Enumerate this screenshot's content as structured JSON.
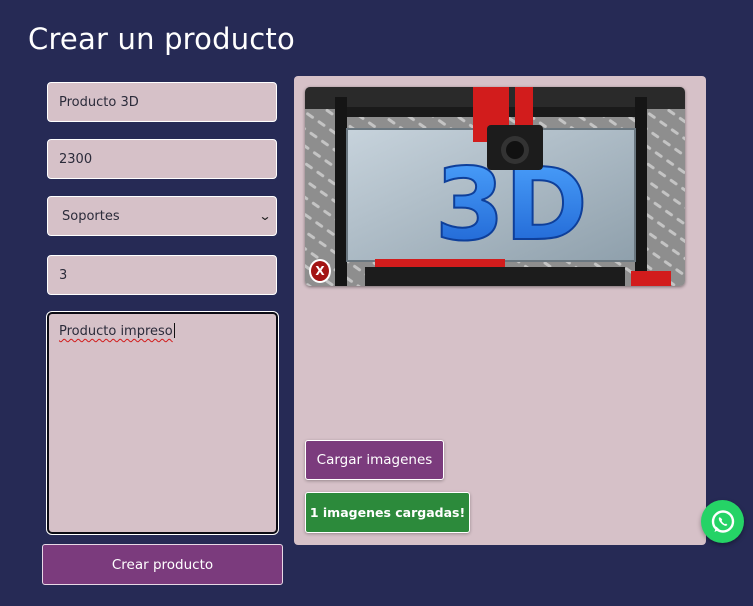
{
  "page": {
    "title": "Crear un producto"
  },
  "form": {
    "name_value": "Producto 3D",
    "price_value": "2300",
    "category_selected": "Soportes",
    "stock_value": "3",
    "description_value": "Producto impreso",
    "submit_label": "Crear producto"
  },
  "images": {
    "remove_label": "X",
    "upload_label": "Cargar imagenes",
    "status_text": "1 imagenes cargadas!"
  },
  "colors": {
    "background": "#262a55",
    "field": "#d6c1c8",
    "primary_button": "#7b3b7d",
    "success": "#2c8a3b",
    "remove": "#a31414",
    "whatsapp": "#25d366"
  },
  "icons": {
    "select_arrow": "chevron-down-icon",
    "chat": "whatsapp-icon"
  }
}
